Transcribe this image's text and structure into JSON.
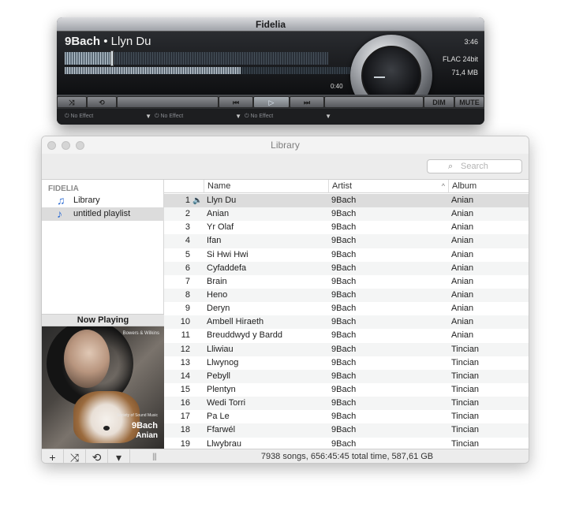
{
  "player": {
    "title": "Fidelia",
    "artist": "9Bach",
    "separator": "•",
    "track": "Llyn Du",
    "elapsed": "0:40",
    "duration": "3:46",
    "format": "FLAC 24bit",
    "filesize": "71,4 MB",
    "progress": 0.57,
    "controls": {
      "dim": "DIM",
      "mute": "MUTE"
    },
    "effects": [
      {
        "label": "No Effect"
      },
      {
        "label": "No Effect"
      },
      {
        "label": "No Effect"
      }
    ]
  },
  "library": {
    "title": "Library",
    "search_placeholder": "Search",
    "sidebar": {
      "heading": "FIDELIA",
      "items": [
        {
          "label": "Library",
          "icon": "music-note-icon"
        },
        {
          "label": "untitled playlist",
          "icon": "playlist-icon"
        }
      ]
    },
    "now_playing": {
      "heading": "Now Playing",
      "brand": "Bowers & Wilkins",
      "subtitle": "Society of Sound Music",
      "artist": "9Bach",
      "album": "Anian"
    },
    "columns": {
      "name": "Name",
      "artist": "Artist",
      "album": "Album"
    },
    "tracks": [
      {
        "num": "1",
        "name": "Llyn Du",
        "artist": "9Bach",
        "album": "Anian"
      },
      {
        "num": "2",
        "name": "Anian",
        "artist": "9Bach",
        "album": "Anian"
      },
      {
        "num": "3",
        "name": "Yr Olaf",
        "artist": "9Bach",
        "album": "Anian"
      },
      {
        "num": "4",
        "name": "Ifan",
        "artist": "9Bach",
        "album": "Anian"
      },
      {
        "num": "5",
        "name": "Si Hwi Hwi",
        "artist": "9Bach",
        "album": "Anian"
      },
      {
        "num": "6",
        "name": "Cyfaddefa",
        "artist": "9Bach",
        "album": "Anian"
      },
      {
        "num": "7",
        "name": "Brain",
        "artist": "9Bach",
        "album": "Anian"
      },
      {
        "num": "8",
        "name": "Heno",
        "artist": "9Bach",
        "album": "Anian"
      },
      {
        "num": "9",
        "name": "Deryn",
        "artist": "9Bach",
        "album": "Anian"
      },
      {
        "num": "10",
        "name": "Ambell Hiraeth",
        "artist": "9Bach",
        "album": "Anian"
      },
      {
        "num": "11",
        "name": "Breuddwyd y Bardd",
        "artist": "9Bach",
        "album": "Anian"
      },
      {
        "num": "12",
        "name": "Lliwiau",
        "artist": "9Bach",
        "album": "Tincian"
      },
      {
        "num": "13",
        "name": "Llwynog",
        "artist": "9Bach",
        "album": "Tincian"
      },
      {
        "num": "14",
        "name": "Pebyll",
        "artist": "9Bach",
        "album": "Tincian"
      },
      {
        "num": "15",
        "name": "Plentyn",
        "artist": "9Bach",
        "album": "Tincian"
      },
      {
        "num": "16",
        "name": "Wedi Torri",
        "artist": "9Bach",
        "album": "Tincian"
      },
      {
        "num": "17",
        "name": "Pa Le",
        "artist": "9Bach",
        "album": "Tincian"
      },
      {
        "num": "18",
        "name": "Ffarwél",
        "artist": "9Bach",
        "album": "Tincian"
      },
      {
        "num": "19",
        "name": "Llwybrau",
        "artist": "9Bach",
        "album": "Tincian"
      }
    ],
    "status": "7938 songs, 656:45:45 total time, 587,61 GB"
  }
}
